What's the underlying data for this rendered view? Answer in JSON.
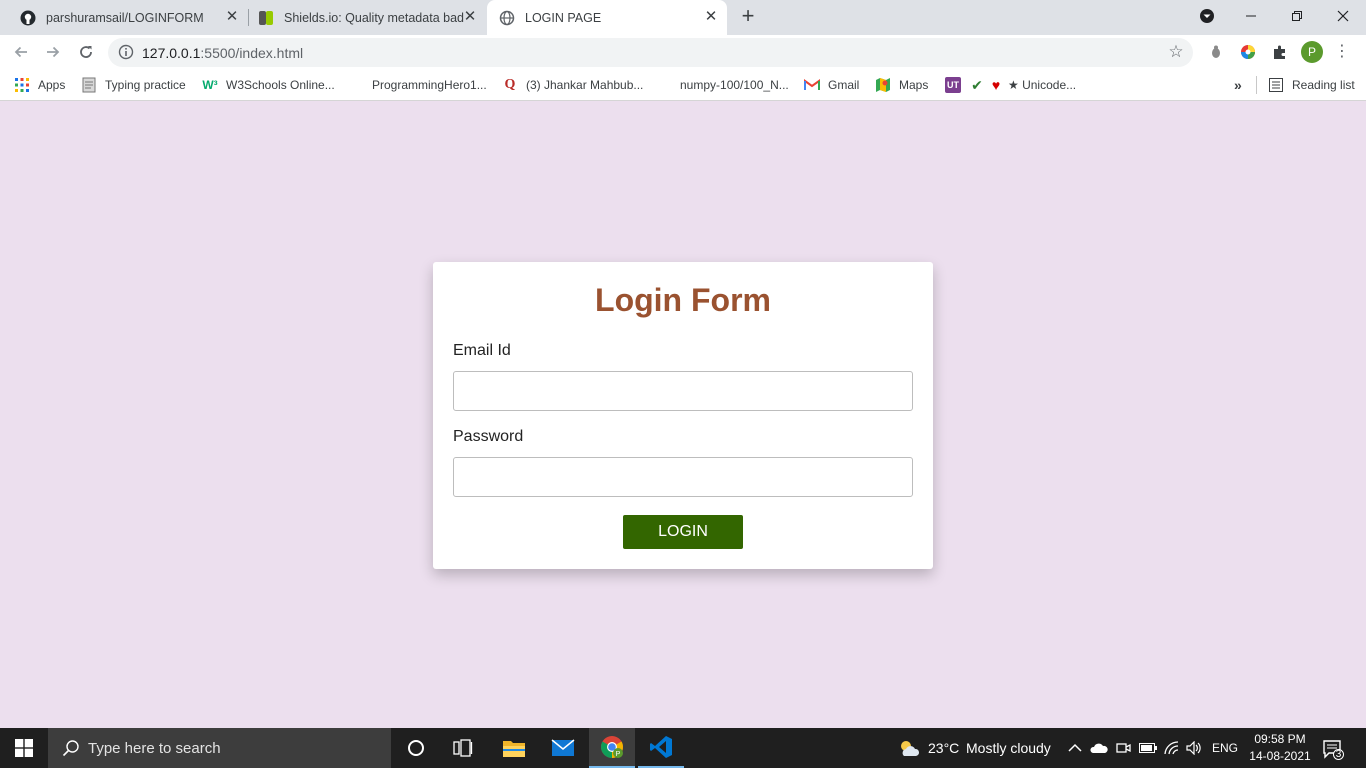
{
  "tabs": [
    {
      "title": "parshuramsail/LOGINFORM",
      "icon": "github-icon"
    },
    {
      "title": "Shields.io: Quality metadata badg",
      "icon": "shields-icon"
    },
    {
      "title": "LOGIN PAGE",
      "icon": "globe-icon",
      "active": true
    }
  ],
  "address": {
    "host": "127.0.0.1",
    "path": ":5500/index.html"
  },
  "bookmarks": [
    {
      "label": "Apps",
      "icon": "apps-grid-icon"
    },
    {
      "label": "Typing practice",
      "icon": "typing-icon"
    },
    {
      "label": "W3Schools Online...",
      "icon": "w3schools-icon"
    },
    {
      "label": "ProgrammingHero1...",
      "icon": ""
    },
    {
      "label": "(3) Jhankar Mahbub...",
      "icon": "quora-icon"
    },
    {
      "label": "numpy-100/100_N...",
      "icon": ""
    },
    {
      "label": "Gmail",
      "icon": "gmail-icon"
    },
    {
      "label": "Maps",
      "icon": "maps-icon"
    },
    {
      "label": "★ Unicode...",
      "icon": "heart-icon"
    }
  ],
  "reading_list": "Reading list",
  "profile_initial": "P",
  "form": {
    "title": "Login Form",
    "email_label": "Email Id",
    "password_label": "Password",
    "button": "LOGIN"
  },
  "taskbar": {
    "search_placeholder": "Type here to search",
    "temperature": "23°C",
    "weather": "Mostly cloudy",
    "lang": "ENG",
    "time": "09:58 PM",
    "date": "14-08-2021",
    "notifications": "3"
  },
  "colors": {
    "page_bg": "#ecdfee",
    "title": "#9a5230",
    "button": "#336600"
  }
}
